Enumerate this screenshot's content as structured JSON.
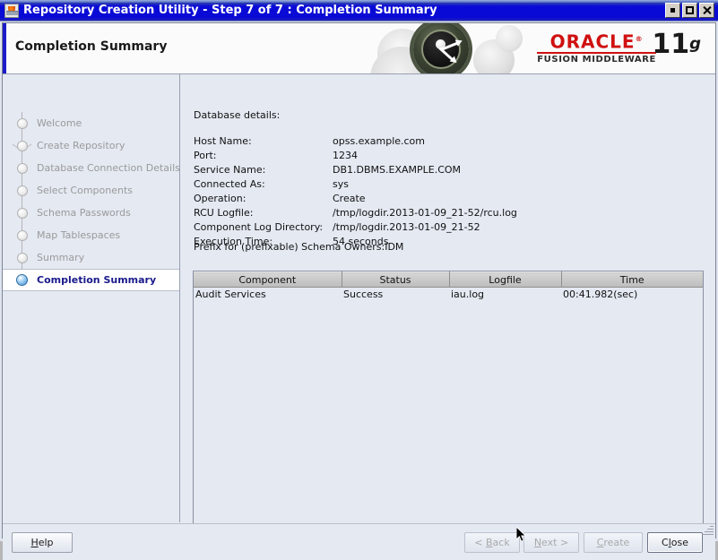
{
  "window": {
    "title": "Repository Creation Utility - Step 7 of 7 : Completion Summary",
    "icon": "java-app-icon",
    "controls": {
      "minimize": "Minimize",
      "maximize": "Maximize",
      "close": "Close"
    }
  },
  "banner": {
    "title": "Completion Summary",
    "brand": "ORACLE",
    "brand_sub": "FUSION MIDDLEWARE",
    "version_number": "11",
    "version_suffix": "g",
    "accent_color": "#1b1bc8",
    "brand_color": "#d01010"
  },
  "sidebar": {
    "items": [
      {
        "label": "Welcome",
        "state": "done"
      },
      {
        "label": "Create Repository",
        "state": "done",
        "branch": true
      },
      {
        "label": "Database Connection Details",
        "state": "done"
      },
      {
        "label": "Select Components",
        "state": "done"
      },
      {
        "label": "Schema Passwords",
        "state": "done"
      },
      {
        "label": "Map Tablespaces",
        "state": "done"
      },
      {
        "label": "Summary",
        "state": "done"
      },
      {
        "label": "Completion Summary",
        "state": "current"
      }
    ]
  },
  "content": {
    "heading": "Database details:",
    "details": [
      {
        "key": "Host Name:",
        "value": "opss.example.com"
      },
      {
        "key": "Port:",
        "value": "1234"
      },
      {
        "key": "Service Name:",
        "value": "DB1.DBMS.EXAMPLE.COM"
      },
      {
        "key": "Connected As:",
        "value": "sys"
      },
      {
        "key": "Operation:",
        "value": "Create"
      },
      {
        "key": "RCU Logfile:",
        "value": "/tmp/logdir.2013-01-09_21-52/rcu.log"
      },
      {
        "key": "Component Log Directory:",
        "value": "/tmp/logdir.2013-01-09_21-52"
      },
      {
        "key": "Execution Time:",
        "value": "54  seconds"
      }
    ],
    "prefix_line": "Prefix for (prefixable) Schema Owners:IDM",
    "table": {
      "columns": [
        "Component",
        "Status",
        "Logfile",
        "Time"
      ],
      "rows": [
        [
          "Audit Services",
          "Success",
          "iau.log",
          "00:41.982(sec)"
        ]
      ]
    }
  },
  "footer": {
    "help": {
      "label": "Help",
      "mnemonic": "H",
      "enabled": true
    },
    "back": {
      "label": "< Back",
      "mnemonic": "B",
      "enabled": false
    },
    "next": {
      "label": "Next >",
      "mnemonic": "N",
      "enabled": false
    },
    "create": {
      "label": "Create",
      "mnemonic": "C",
      "enabled": false
    },
    "close": {
      "label": "Close",
      "mnemonic": "l",
      "enabled": true,
      "focused": true
    }
  }
}
